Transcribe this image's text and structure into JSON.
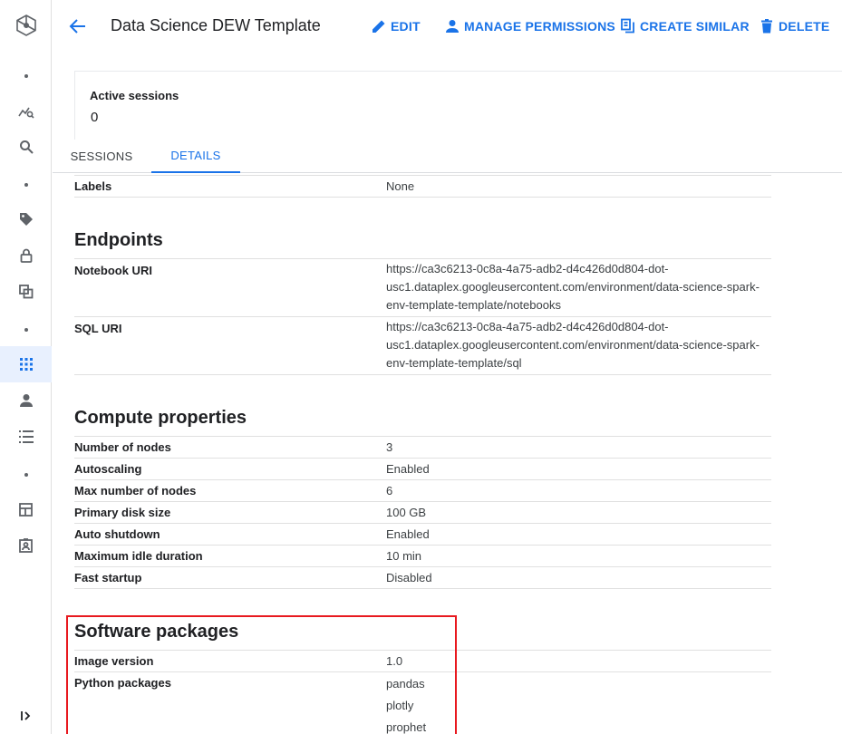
{
  "header": {
    "title": "Data Science DEW Template",
    "actions": {
      "edit": "EDIT",
      "manage_permissions": "MANAGE PERMISSIONS",
      "create_similar": "CREATE SIMILAR",
      "delete": "DELETE"
    }
  },
  "card": {
    "label": "Active sessions",
    "value": "0"
  },
  "tabs": {
    "sessions": "SESSIONS",
    "details": "DETAILS",
    "active": "details"
  },
  "labels_row": {
    "key": "Labels",
    "value": "None"
  },
  "endpoints": {
    "heading": "Endpoints",
    "rows": [
      {
        "key": "Notebook URI",
        "lines": [
          "https://ca3c6213-0c8a-4a75-adb2-d4c426d0d804-dot-",
          "usc1.dataplex.googleusercontent.com/environment/data-science-spark-",
          "env-template-template/notebooks"
        ]
      },
      {
        "key": "SQL URI",
        "lines": [
          "https://ca3c6213-0c8a-4a75-adb2-d4c426d0d804-dot-",
          "usc1.dataplex.googleusercontent.com/environment/data-science-spark-",
          "env-template-template/sql"
        ]
      }
    ]
  },
  "compute": {
    "heading": "Compute properties",
    "rows": [
      {
        "key": "Number of nodes",
        "value": "3"
      },
      {
        "key": "Autoscaling",
        "value": "Enabled"
      },
      {
        "key": "Max number of nodes",
        "value": "6"
      },
      {
        "key": "Primary disk size",
        "value": "100 GB"
      },
      {
        "key": "Auto shutdown",
        "value": "Enabled"
      },
      {
        "key": "Maximum idle duration",
        "value": "10 min"
      },
      {
        "key": "Fast startup",
        "value": "Disabled"
      }
    ]
  },
  "software": {
    "heading": "Software packages",
    "image_version": {
      "key": "Image version",
      "value": "1.0"
    },
    "python_packages": {
      "key": "Python packages",
      "values": [
        "pandas",
        "plotly",
        "prophet"
      ]
    }
  },
  "colors": {
    "accent": "#1a73e8",
    "highlight": "#e8191f",
    "rail_active_bg": "#e8f0fe"
  }
}
